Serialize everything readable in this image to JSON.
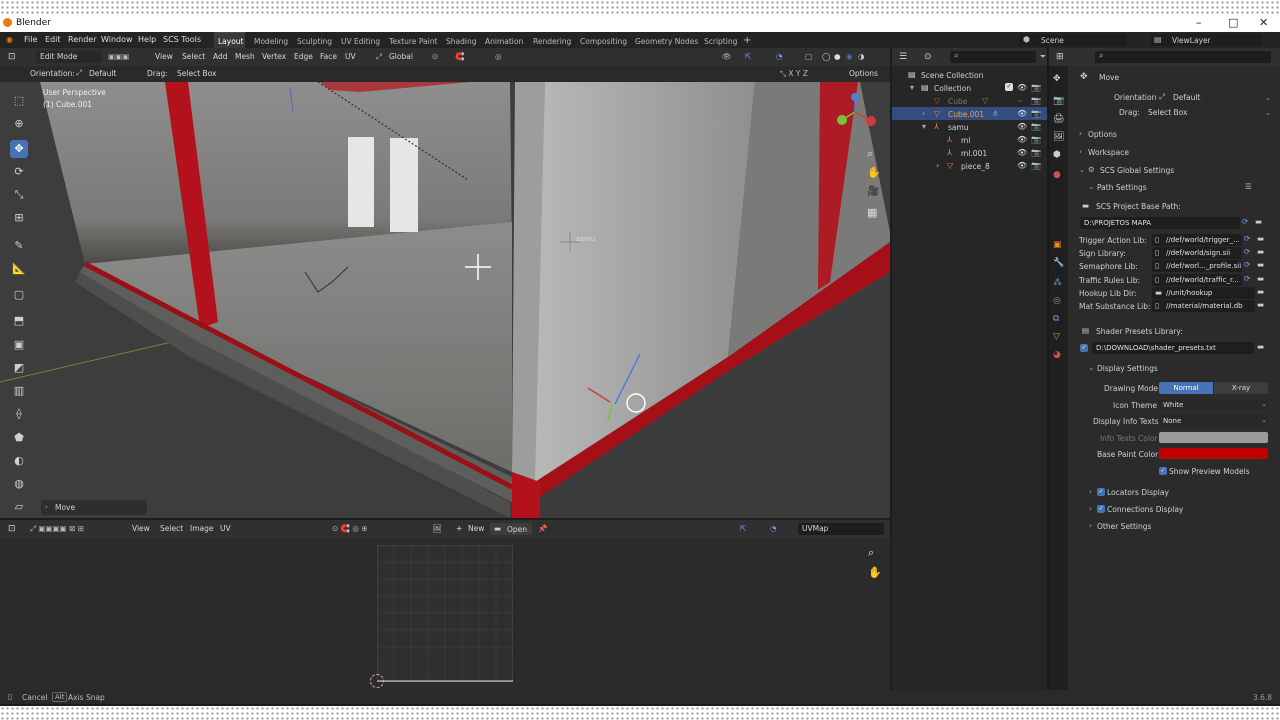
{
  "app": {
    "title": "Blender",
    "version": "3.6.8"
  },
  "menus": [
    "File",
    "Edit",
    "Render",
    "Window",
    "Help",
    "SCS Tools"
  ],
  "workspaces": [
    "Layout",
    "Modeling",
    "Sculpting",
    "UV Editing",
    "Texture Paint",
    "Shading",
    "Animation",
    "Rendering",
    "Compositing",
    "Geometry Nodes",
    "Scripting"
  ],
  "active_workspace": "Layout",
  "scene": "Scene",
  "view_layer": "ViewLayer",
  "viewport_header": {
    "mode": "Edit Mode",
    "menus": [
      "View",
      "Select",
      "Add",
      "Mesh",
      "Vertex",
      "Edge",
      "Face",
      "UV"
    ],
    "transform_orientation": "Global",
    "orientation_label": "Orientation:",
    "orientation": "Default",
    "drag_label": "Drag:",
    "drag": "Select Box",
    "options": "Options"
  },
  "viewport": {
    "view_name": "User Perspective",
    "object_name": "(1) Cube.001",
    "empty_label": "samu",
    "last_op": "Move"
  },
  "uv_editor": {
    "menus": [
      "View",
      "Select",
      "Image",
      "UV"
    ],
    "new": "New",
    "open": "Open",
    "uvmap": "UVMap"
  },
  "outliner": {
    "search_placeholder": "",
    "items": [
      {
        "label": "Scene Collection",
        "indent": 0,
        "icon": "collection",
        "selected": false
      },
      {
        "label": "Collection",
        "indent": 1,
        "icon": "collection",
        "selected": false
      },
      {
        "label": "Cube",
        "indent": 2,
        "icon": "mesh",
        "selected": false,
        "dim": true
      },
      {
        "label": "Cube.001",
        "indent": 2,
        "icon": "mesh",
        "selected": true
      },
      {
        "label": "samu",
        "indent": 2,
        "icon": "empty",
        "selected": false
      },
      {
        "label": "ml",
        "indent": 3,
        "icon": "empty",
        "selected": false
      },
      {
        "label": "ml.001",
        "indent": 3,
        "icon": "empty",
        "selected": false
      },
      {
        "label": "piece_8",
        "indent": 3,
        "icon": "mesh",
        "selected": false
      }
    ]
  },
  "properties": {
    "tool_name": "Move",
    "orientation_label": "Orientation",
    "orientation": "Default",
    "drag_label": "Drag:",
    "drag": "Select Box",
    "options": "Options",
    "workspace": "Workspace",
    "scs_global": "SCS Global Settings",
    "path_settings": "Path Settings",
    "project_base_label": "SCS Project Base Path:",
    "project_base": "D:\\PROJETOS MAPA",
    "libs": [
      {
        "label": "Trigger Action Lib:",
        "value": "//def/world/trigger_..."
      },
      {
        "label": "Sign Library:",
        "value": "//def/world/sign.sii"
      },
      {
        "label": "Semaphore Lib:",
        "value": "//def/worl..._profile.sii"
      },
      {
        "label": "Traffic Rules Lib:",
        "value": "//def/world/traffic_r..."
      },
      {
        "label": "Hookup Lib Dir:",
        "value": "//unit/hookup"
      },
      {
        "label": "Mat Substance Lib:",
        "value": "//material/material.db"
      }
    ],
    "shader_presets_label": "Shader Presets Library:",
    "shader_presets": "D:\\DOWNLOAD\\shader_presets.txt",
    "display_settings": "Display Settings",
    "drawing_mode_label": "Drawing Mode",
    "drawing_mode_options": [
      "Normal",
      "X-ray"
    ],
    "icon_theme_label": "Icon Theme",
    "icon_theme": "White",
    "display_info_label": "Display Info Texts",
    "display_info": "None",
    "info_color_label": "Info Texts Color",
    "base_paint_label": "Base Paint Color",
    "base_paint_color": "#c00000",
    "show_preview": "Show Preview Models",
    "locators_display": "Locators Display",
    "connections_display": "Connections Display",
    "other_settings": "Other Settings"
  },
  "statusbar": {
    "cancel": "Cancel",
    "alt_key": "Alt",
    "axis_snap": "Axis Snap"
  },
  "colors": {
    "accent": "#4772b3",
    "red_beam": "#b3121c"
  }
}
